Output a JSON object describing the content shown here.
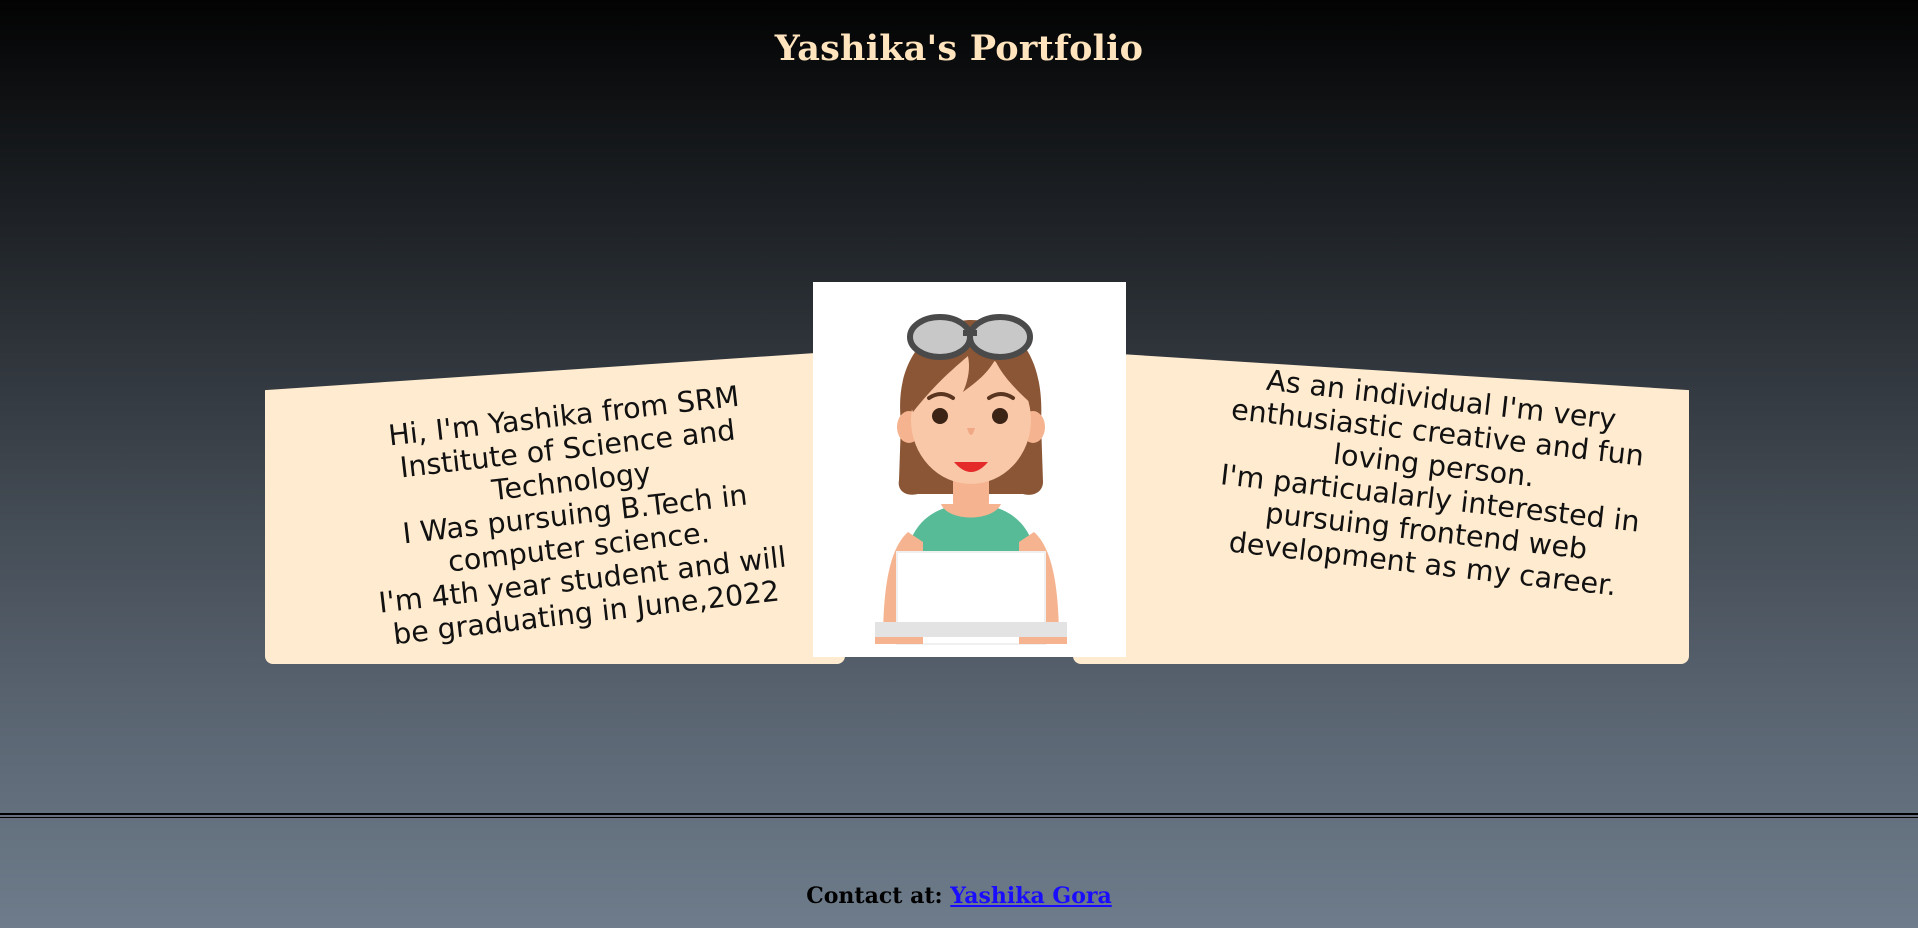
{
  "header": {
    "title": "Yashika's Portfolio"
  },
  "about_left": {
    "lines": [
      "Hi, I'm Yashika from SRM",
      "Institute of Science and",
      "Technology",
      "I Was pursuing B.Tech in",
      "computer science.",
      "I'm 4th year student and will",
      "be graduating in June,2022"
    ]
  },
  "about_right": {
    "lines": [
      "As an individual I'm very",
      "enthusiastic creative and fun",
      "loving person.",
      "I'm particualarly interested in",
      "pursuing frontend web",
      "development as my career."
    ]
  },
  "footer": {
    "prefix": "Contact at:",
    "link_text": "Yashika Gora"
  },
  "colors": {
    "card_background": "#ffebcf",
    "title_color": "#ffe4bd",
    "link_color": "#1a0dff"
  },
  "icons": {
    "profile_image": "avatar-girl-with-sunglasses-laptop"
  }
}
